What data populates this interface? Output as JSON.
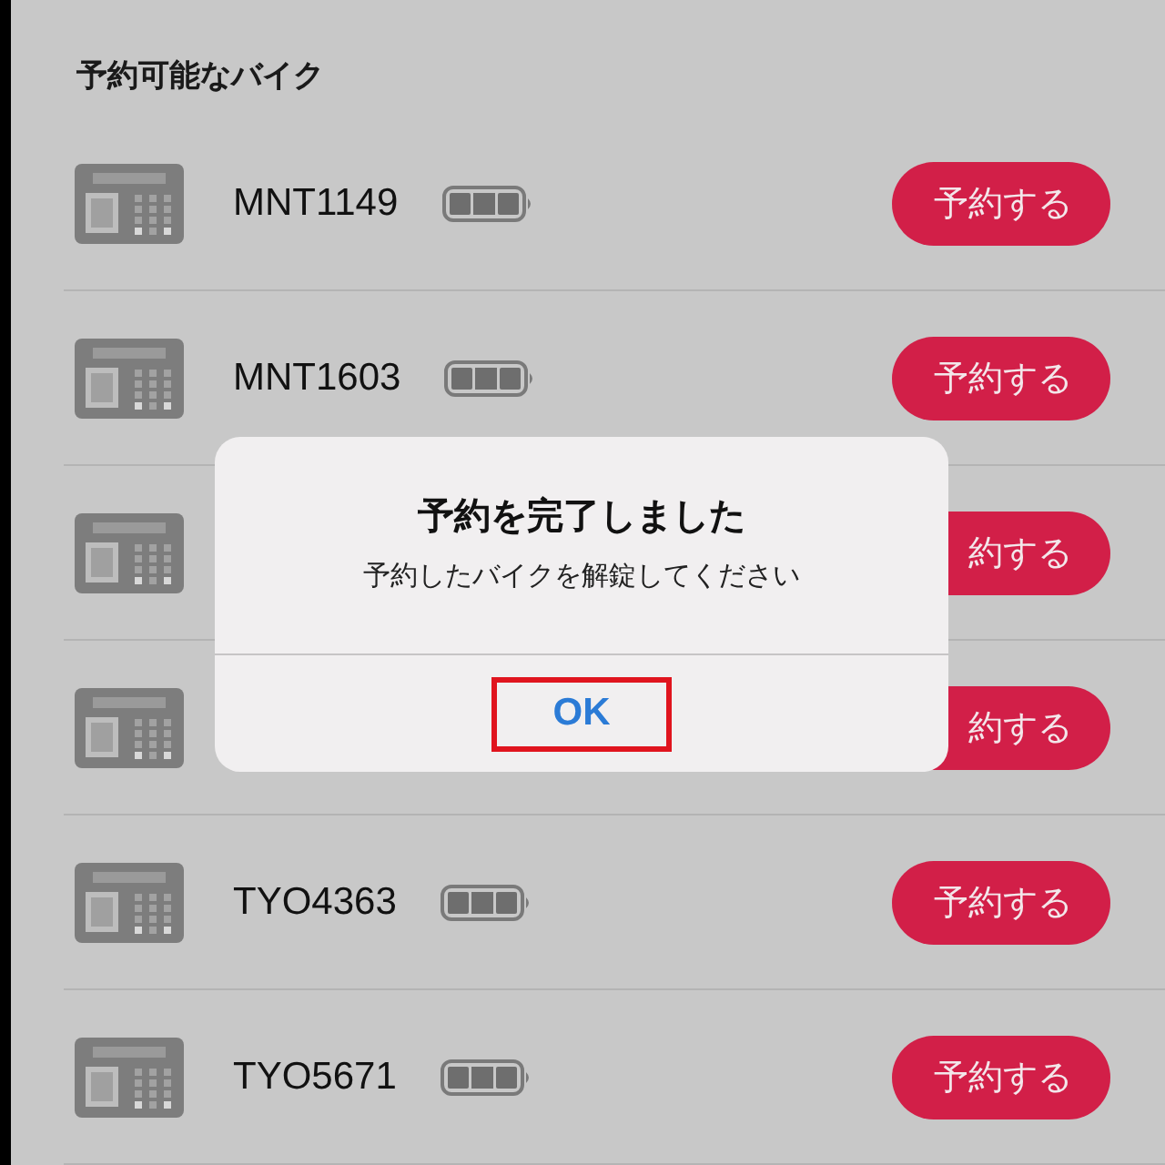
{
  "section_title": "予約可能なバイク",
  "bikes": [
    {
      "name": "MNT1149",
      "battery": true,
      "button": "予約する"
    },
    {
      "name": "MNT1603",
      "battery": true,
      "button": "予約する"
    },
    {
      "battery": false,
      "button": "約する"
    },
    {
      "battery": false,
      "button": "約する"
    },
    {
      "name": "TYO4363",
      "battery": true,
      "button": "予約する"
    },
    {
      "name": "TYO5671",
      "battery": true,
      "button": "予約する"
    }
  ],
  "alert": {
    "title": "予約を完了しました",
    "message": "予約したバイクを解錠してください",
    "button": {
      "label": "OK",
      "highlighted": true
    }
  }
}
